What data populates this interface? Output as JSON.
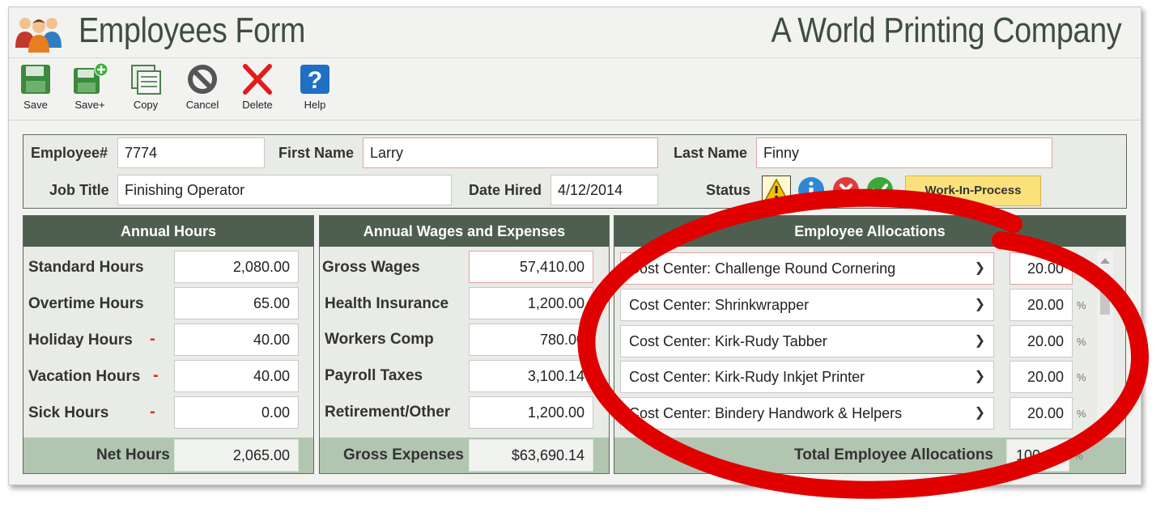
{
  "app": {
    "title": "Employees Form",
    "company": "A World Printing Company"
  },
  "toolbar": {
    "save": "Save",
    "save_plus": "Save+",
    "copy": "Copy",
    "cancel": "Cancel",
    "delete": "Delete",
    "help": "Help"
  },
  "header": {
    "employee_label": "Employee#",
    "employee_value": "7774",
    "first_name_label": "First Name",
    "first_name_value": "Larry",
    "last_name_label": "Last Name",
    "last_name_value": "Finny",
    "job_title_label": "Job Title",
    "job_title_value": "Finishing Operator",
    "date_hired_label": "Date Hired",
    "date_hired_value": "4/12/2014",
    "status_label": "Status",
    "status_value": "Work-In-Process"
  },
  "annual_hours": {
    "title": "Annual Hours",
    "rows": [
      {
        "label": "Standard Hours",
        "value": "2,080.00"
      },
      {
        "label": "Overtime Hours",
        "value": "65.00"
      },
      {
        "label": "Holiday Hours",
        "value": "40.00",
        "minus": "-"
      },
      {
        "label": "Vacation Hours",
        "value": "40.00",
        "minus": "-"
      },
      {
        "label": "Sick Hours",
        "value": "0.00",
        "minus": "-"
      }
    ],
    "total_label": "Net Hours",
    "total_value": "2,065.00"
  },
  "wages": {
    "title": "Annual Wages and Expenses",
    "rows": [
      {
        "label": "Gross Wages",
        "value": "57,410.00"
      },
      {
        "label": "Health Insurance",
        "value": "1,200.00"
      },
      {
        "label": "Workers Comp",
        "value": "780.00"
      },
      {
        "label": "Payroll Taxes",
        "value": "3,100.14"
      },
      {
        "label": "Retirement/Other",
        "value": "1,200.00"
      }
    ],
    "total_label": "Gross Expenses",
    "total_value": "$63,690.14"
  },
  "allocations": {
    "title": "Employee Allocations",
    "pct_symbol": "%",
    "rows": [
      {
        "cost_center": "Cost Center: Challenge Round Cornering",
        "percent": "20.00"
      },
      {
        "cost_center": "Cost Center: Shrinkwrapper",
        "percent": "20.00"
      },
      {
        "cost_center": "Cost Center: Kirk-Rudy Tabber",
        "percent": "20.00"
      },
      {
        "cost_center": "Cost Center: Kirk-Rudy Inkjet Printer",
        "percent": "20.00"
      },
      {
        "cost_center": "Cost Center: Bindery Handwork & Helpers",
        "percent": "20.00"
      }
    ],
    "total_label": "Total Employee Allocations",
    "total_value": "100.00"
  },
  "colors": {
    "section_header": "#4f5f4f",
    "section_footer": "#b1c5b0",
    "annotation": "#e00000",
    "status_active": "#fbe17c"
  },
  "icons": [
    "people-icon",
    "save-icon",
    "save-plus-icon",
    "copy-icon",
    "cancel-icon",
    "delete-icon",
    "help-icon",
    "warning-icon",
    "info-icon",
    "error-icon",
    "check-icon"
  ]
}
